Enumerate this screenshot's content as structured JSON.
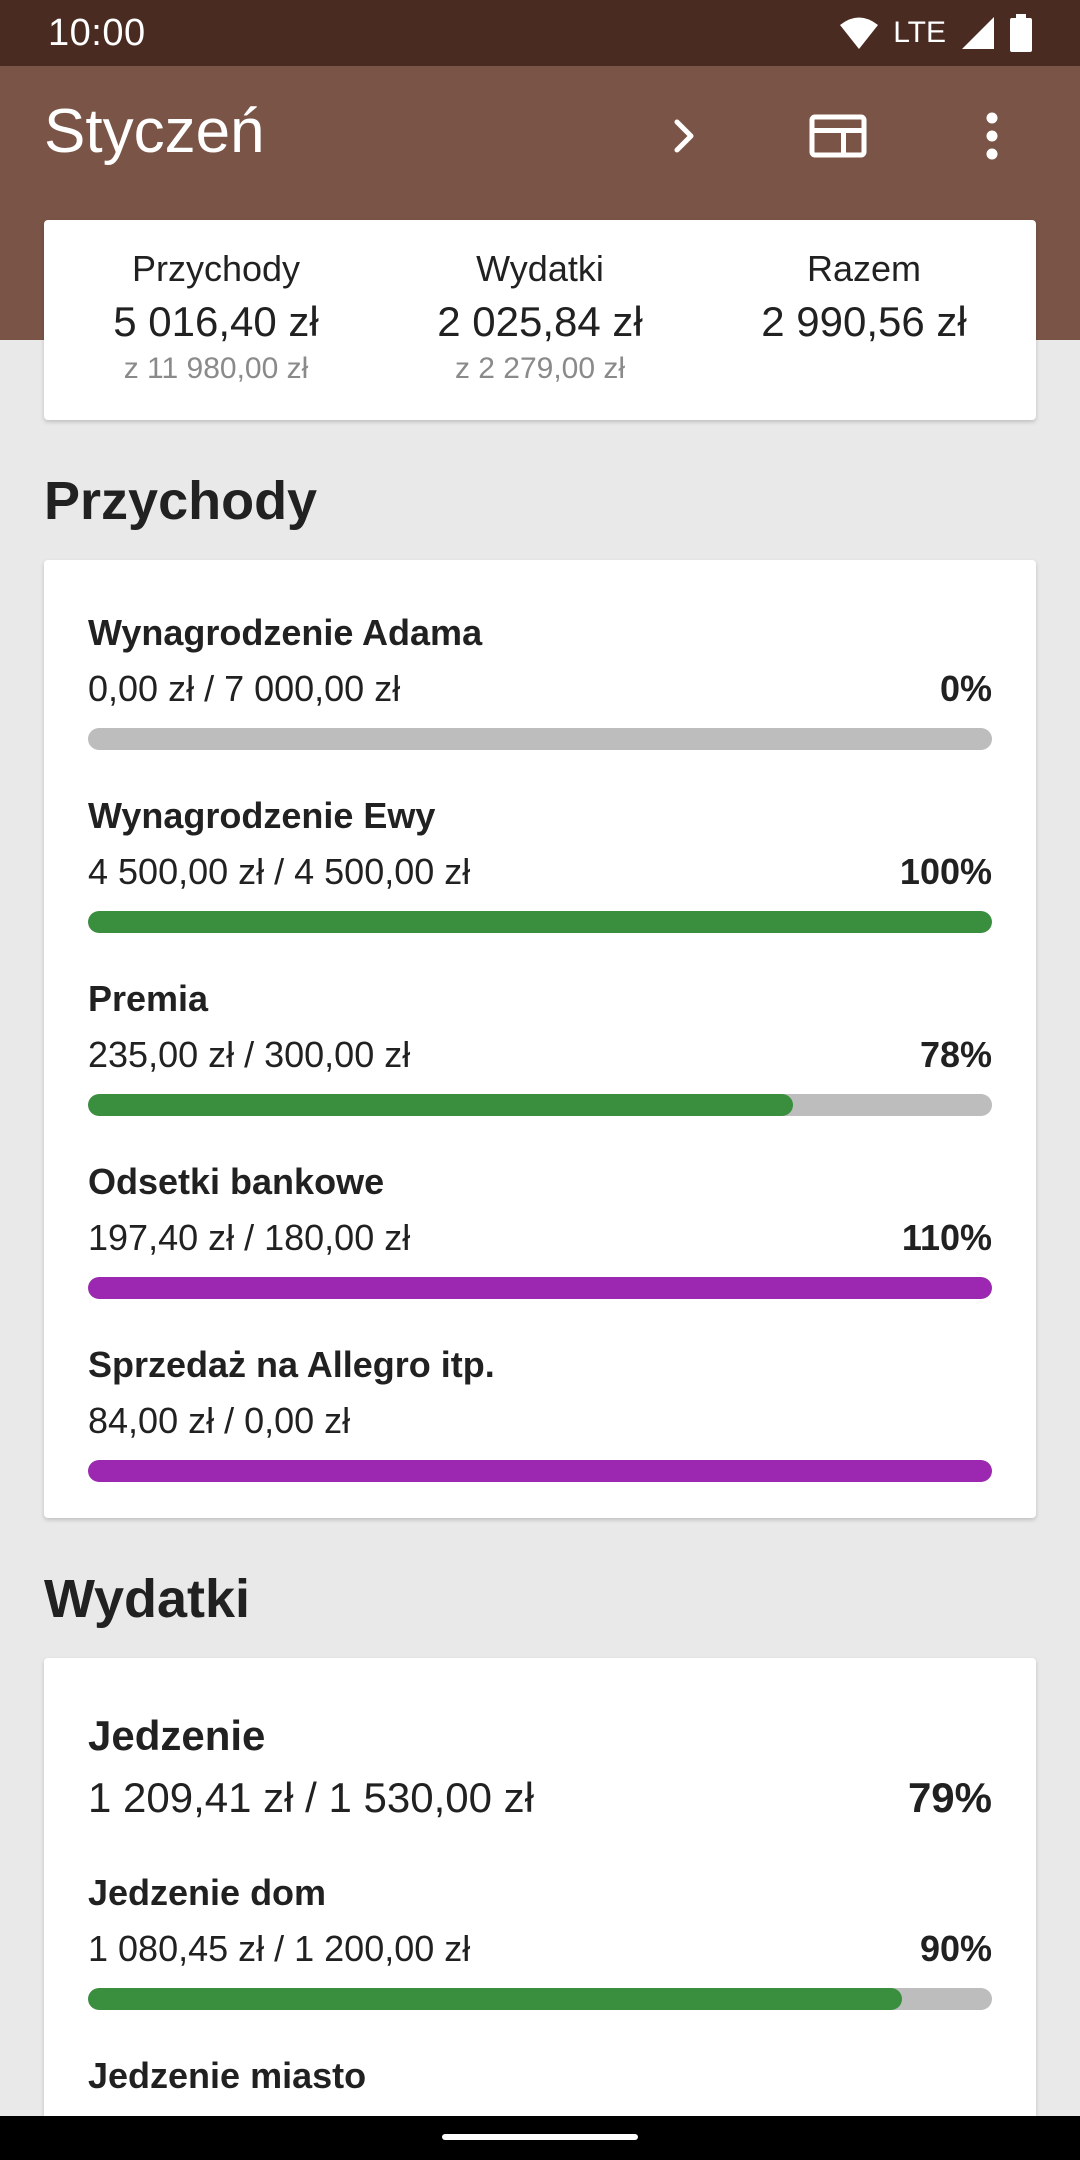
{
  "status_bar": {
    "time": "10:00",
    "network": "LTE"
  },
  "app_bar": {
    "title": "Styczeń",
    "actions": [
      "chevron-right-icon",
      "view-icon",
      "more-vert-icon"
    ]
  },
  "colors": {
    "status_bar": "#4a2b21",
    "app_bar": "#7a5547",
    "bar_green": "#3a8f3f",
    "bar_purple": "#9c27b0",
    "bar_track": "#bdbdbd"
  },
  "summary": {
    "income": {
      "label": "Przychody",
      "value": "5 016,40 zł",
      "sub": "z 11 980,00 zł"
    },
    "expenses": {
      "label": "Wydatki",
      "value": "2 025,84 zł",
      "sub": "z 2 279,00 zł"
    },
    "total": {
      "label": "Razem",
      "value": "2 990,56 zł"
    }
  },
  "income_section": {
    "title": "Przychody",
    "items": [
      {
        "name": "Wynagrodzenie Adama",
        "amount": "0,00 zł / 7 000,00 zł",
        "percent": "0%",
        "fill": 0,
        "color": "#3a8f3f"
      },
      {
        "name": "Wynagrodzenie Ewy",
        "amount": "4 500,00 zł / 4 500,00 zł",
        "percent": "100%",
        "fill": 1,
        "color": "#3a8f3f"
      },
      {
        "name": "Premia",
        "amount": "235,00 zł / 300,00 zł",
        "percent": "78%",
        "fill": 0.78,
        "color": "#3a8f3f"
      },
      {
        "name": "Odsetki bankowe",
        "amount": "197,40 zł / 180,00 zł",
        "percent": "110%",
        "fill": 1,
        "color": "#9c27b0"
      },
      {
        "name": "Sprzedaż na Allegro itp.",
        "amount": "84,00 zł / 0,00 zł",
        "percent": "",
        "fill": 1,
        "color": "#9c27b0"
      }
    ]
  },
  "expenses_section": {
    "title": "Wydatki",
    "group": {
      "name": "Jedzenie",
      "amount": "1 209,41 zł / 1 530,00 zł",
      "percent": "79%"
    },
    "items": [
      {
        "name": "Jedzenie dom",
        "amount": "1 080,45 zł / 1 200,00 zł",
        "percent": "90%",
        "fill": 0.9,
        "color": "#3a8f3f"
      },
      {
        "name": "Jedzenie miasto"
      }
    ]
  }
}
